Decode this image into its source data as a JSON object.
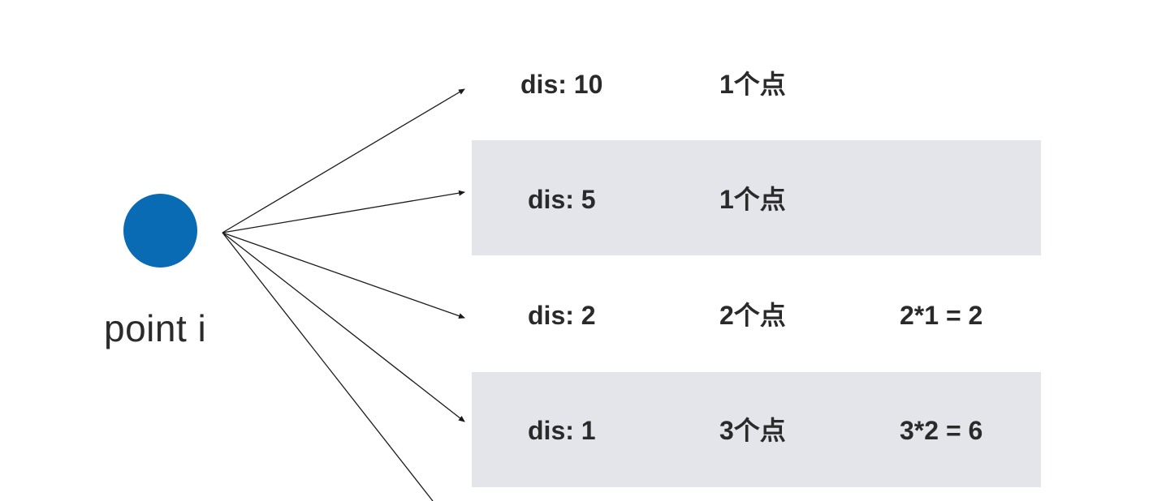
{
  "point": {
    "label": "point i",
    "color": "#0a6bb5"
  },
  "band_color": "#e3e5ea",
  "rows": [
    {
      "dis": "dis: 10",
      "count": "1个点",
      "calc": ""
    },
    {
      "dis": "dis: 5",
      "count": "1个点",
      "calc": ""
    },
    {
      "dis": "dis: 2",
      "count": "2个点",
      "calc": "2*1 = 2"
    },
    {
      "dis": "dis: 1",
      "count": "3个点",
      "calc": "3*2 = 6"
    }
  ]
}
